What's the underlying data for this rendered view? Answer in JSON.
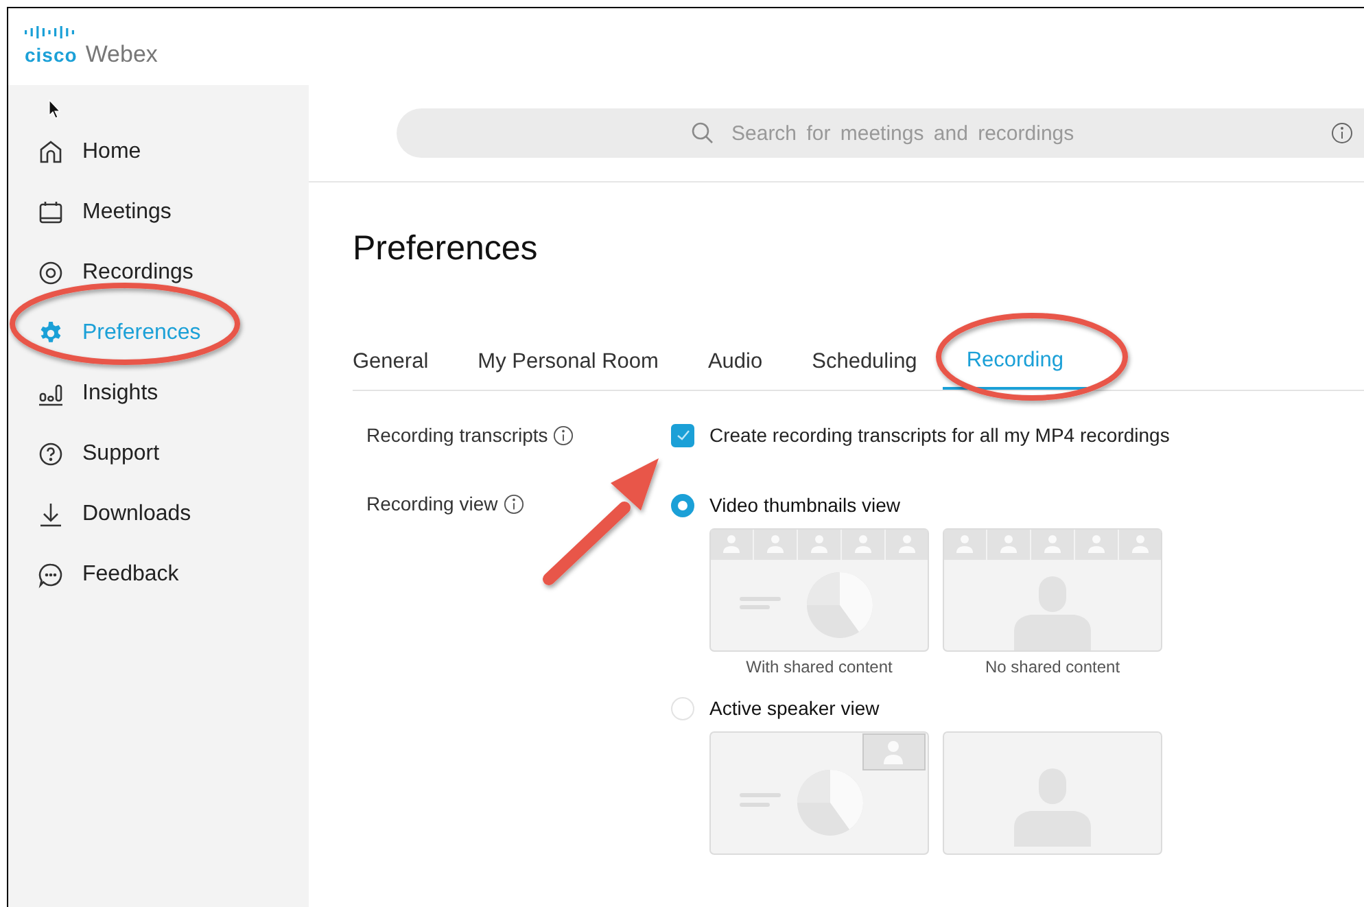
{
  "logo": {
    "brand": "cisco",
    "product": "Webex"
  },
  "sidebar": {
    "items": [
      {
        "label": "Home",
        "kind": "home",
        "selected": false
      },
      {
        "label": "Meetings",
        "kind": "calendar",
        "selected": false
      },
      {
        "label": "Recordings",
        "kind": "record",
        "selected": false
      },
      {
        "label": "Preferences",
        "kind": "gear",
        "selected": true
      },
      {
        "label": "Insights",
        "kind": "chart",
        "selected": false
      },
      {
        "label": "Support",
        "kind": "help",
        "selected": false
      },
      {
        "label": "Downloads",
        "kind": "download",
        "selected": false
      },
      {
        "label": "Feedback",
        "kind": "chat",
        "selected": false
      }
    ]
  },
  "search": {
    "placeholder": "Search for meetings and recordings"
  },
  "page_title": "Preferences",
  "tabs": [
    {
      "label": "General",
      "selected": false
    },
    {
      "label": "My Personal Room",
      "selected": false
    },
    {
      "label": "Audio",
      "selected": false
    },
    {
      "label": "Scheduling",
      "selected": false
    },
    {
      "label": "Recording",
      "selected": true
    }
  ],
  "transcripts": {
    "label": "Recording transcripts",
    "option": "Create recording transcripts for all my MP4 recordings",
    "checked": true
  },
  "recording_view": {
    "label": "Recording view",
    "options": [
      {
        "label": "Video thumbnails view",
        "selected": true,
        "kind": "grid",
        "thumbnails": [
          {
            "kind": "shared",
            "caption": "With shared content"
          },
          {
            "kind": "none",
            "caption": "No shared content"
          }
        ]
      },
      {
        "label": "Active speaker view",
        "selected": false,
        "kind": "speaker",
        "thumbnails": [
          {
            "kind": "shared"
          },
          {
            "kind": "none"
          }
        ]
      }
    ]
  }
}
